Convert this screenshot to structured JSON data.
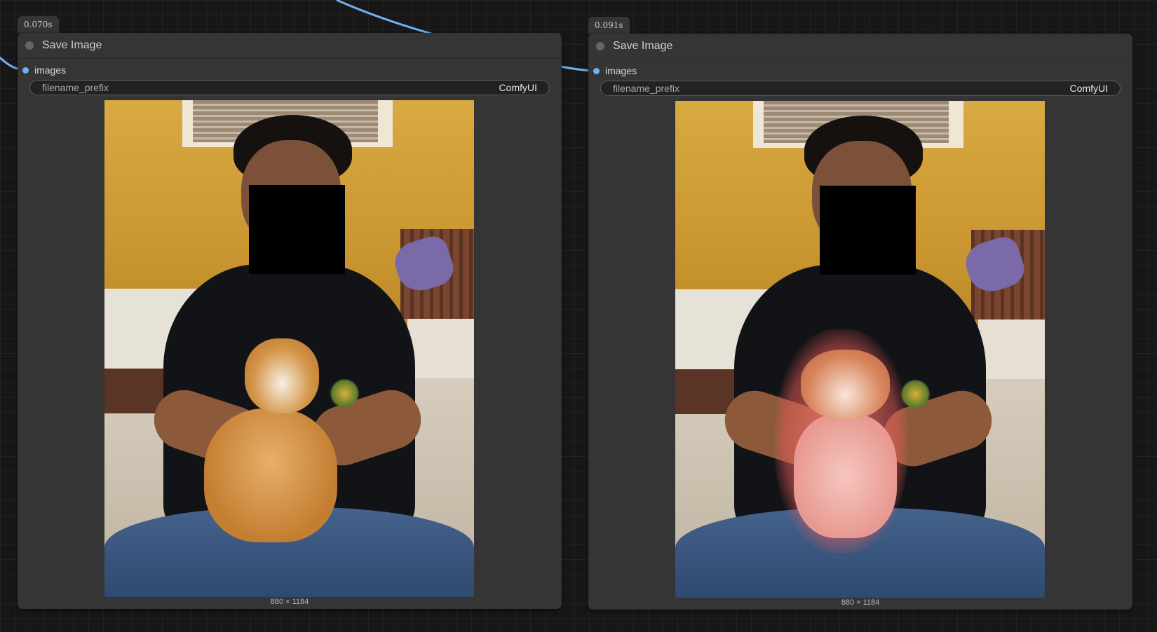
{
  "nodes": [
    {
      "timing": "0.070s",
      "title": "Save Image",
      "input_label": "images",
      "widget": {
        "name": "filename_prefix",
        "value": "ComfyUI"
      },
      "preview": {
        "subject": "cat",
        "dimensions": "880 × 1184"
      }
    },
    {
      "timing": "0.091s",
      "title": "Save Image",
      "input_label": "images",
      "widget": {
        "name": "filename_prefix",
        "value": "ComfyUI"
      },
      "preview": {
        "subject": "dog",
        "dimensions": "880 × 1184"
      }
    }
  ],
  "colors": {
    "link": "#6fb2f4",
    "node_bg": "#353535",
    "canvas_bg": "#171717"
  }
}
